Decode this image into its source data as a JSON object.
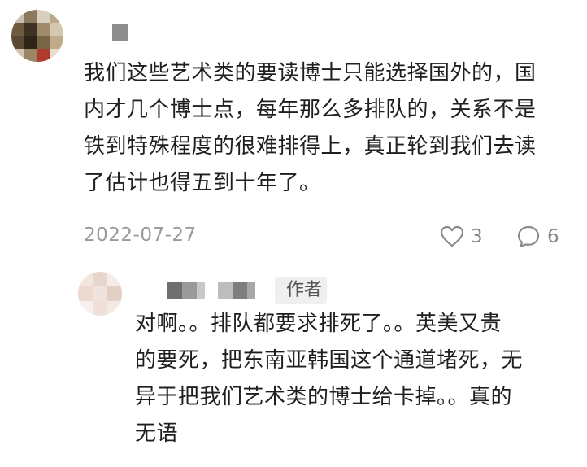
{
  "comment": {
    "text": "我们这些艺术类的要读博士只能选择国外的，国\n内才几个博士点，每年那么多排队的，关系不是\n铁到特殊程度的很难排得上，真正轮到我们去读\n了估计也得五到十年了。",
    "date": "2022-07-27",
    "like_count": "3",
    "reply_count": "6",
    "like_icon": "heart-icon",
    "reply_icon": "comment-bubble-icon"
  },
  "reply": {
    "author_badge": "作者",
    "text": "对啊。。排队都要求排死了。。英美又贵\n的要死，把东南亚韩国这个通道堵死，无\n异于把我们艺术类的博士给卡掉。。真的\n无语"
  },
  "colors": {
    "text": "#1f1f1f",
    "meta": "#9a9a9a",
    "badge_bg": "#efefef"
  }
}
